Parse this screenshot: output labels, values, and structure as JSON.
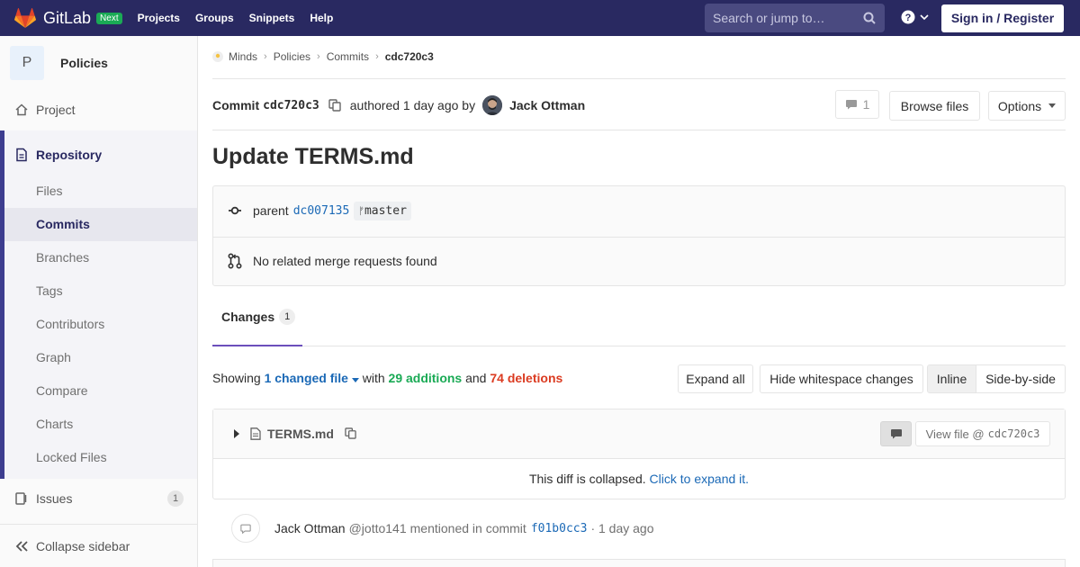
{
  "navbar": {
    "brand": "GitLab",
    "badge": "Next",
    "links": [
      "Projects",
      "Groups",
      "Snippets",
      "Help"
    ],
    "search_placeholder": "Search or jump to…",
    "sign_in": "Sign in / Register",
    "brand_color": "#292961"
  },
  "sidebar": {
    "project_initial": "P",
    "project_name": "Policies",
    "project_item": "Project",
    "repository": "Repository",
    "repo_items": [
      "Files",
      "Commits",
      "Branches",
      "Tags",
      "Contributors",
      "Graph",
      "Compare",
      "Charts",
      "Locked Files"
    ],
    "active_item": "Commits",
    "issues": "Issues",
    "issues_count": "1",
    "collapse": "Collapse sidebar"
  },
  "breadcrumb": [
    "Minds",
    "Policies",
    "Commits",
    "cdc720c3"
  ],
  "commit": {
    "label": "Commit",
    "sha": "cdc720c3",
    "authored": "authored 1 day ago by",
    "author": "Jack Ottman",
    "comment_count": "1",
    "browse_files": "Browse files",
    "options": "Options",
    "title": "Update TERMS.md",
    "parent_label": "parent",
    "parent_sha": "dc007135",
    "branch": "master",
    "no_mr": "No related merge requests found"
  },
  "changes": {
    "tab_label": "Changes",
    "tab_count": "1",
    "showing": "Showing",
    "changed_file": "1 changed file",
    "with": "with",
    "additions": "29 additions",
    "and": "and",
    "deletions": "74 deletions",
    "expand_all": "Expand all",
    "hide_whitespace": "Hide whitespace changes",
    "inline": "Inline",
    "side_by_side": "Side-by-side"
  },
  "diff": {
    "filename": "TERMS.md",
    "view_file_prefix": "View file @",
    "view_file_sha": "cdc720c3",
    "collapsed_text": "This diff is collapsed.",
    "expand_link": "Click to expand it."
  },
  "note": {
    "author": "Jack Ottman",
    "handle": "@jotto141",
    "text": "mentioned in commit",
    "sha": "f01b0cc3",
    "time": "· 1 day ago"
  }
}
